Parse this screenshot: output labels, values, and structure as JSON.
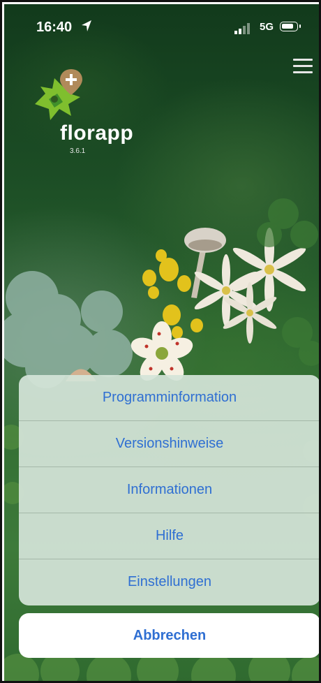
{
  "status_bar": {
    "time": "16:40",
    "network": "5G",
    "icons": [
      "location-arrow-icon",
      "signal-icon",
      "battery-icon"
    ]
  },
  "header": {
    "menu_icon": "hamburger-menu-icon"
  },
  "app": {
    "name": "florapp",
    "version": "3.6.1",
    "logo_icon": "florapp-leaf-logo"
  },
  "action_sheet": {
    "items": [
      {
        "label": "Programminformation"
      },
      {
        "label": "Versionshinweise"
      },
      {
        "label": "Informationen"
      },
      {
        "label": "Hilfe"
      },
      {
        "label": "Einstellungen"
      }
    ],
    "cancel_label": "Abbrechen"
  },
  "colors": {
    "action_text": "#2f6fd2",
    "sheet_background": "#d4e4d8",
    "cancel_background": "#ffffff"
  }
}
